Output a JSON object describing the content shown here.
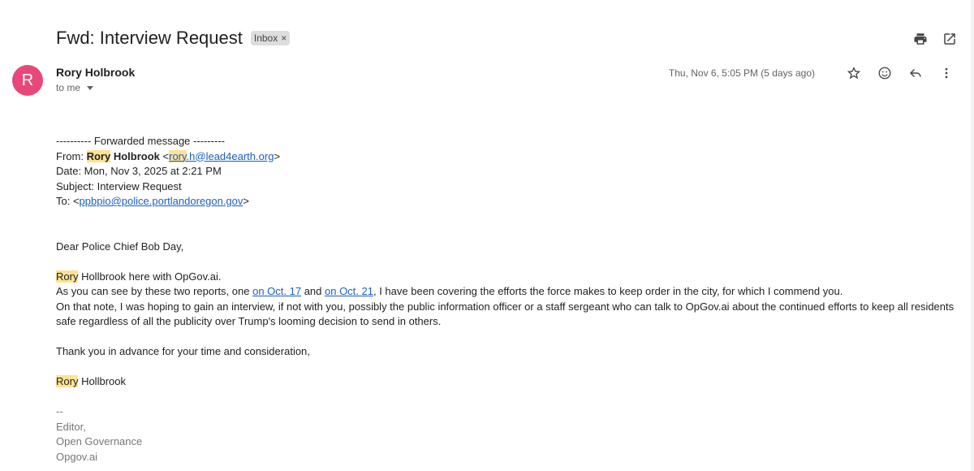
{
  "subject": "Fwd: Interview Request",
  "label": "Inbox",
  "sender": {
    "initial": "R",
    "name": "Rory Holbrook",
    "to": "to me",
    "avatar_color": "#e8477a"
  },
  "timestamp": "Thu, Nov 6, 5:05 PM (5 days ago)",
  "icons": [
    "print-icon",
    "open-in-new-icon",
    "star-icon",
    "emoji-icon",
    "reply-icon",
    "more-vert-icon"
  ],
  "forwarded": {
    "header": "---------- Forwarded message ---------",
    "from_label": "From:",
    "from_first": "Rory",
    "from_last": "Holbrook",
    "email_lt": "<",
    "email_user": "rory",
    "email_rest": ".h@lead4earth.org",
    "email_gt": ">",
    "date": "Date: Mon, Nov 3, 2025 at 2:21 PM",
    "subject": "Subject: Interview Request",
    "to_label": "To: <",
    "to_email": "ppbpio@police.portlandoregon.gov",
    "to_gt": ">"
  },
  "message": {
    "greeting": "Dear Police Chief Bob Day,",
    "intro_name": "Rory",
    "intro_rest": " Hollbrook here with OpGov.ai.",
    "p2_a": "As you can see by these two reports, one ",
    "link1": "on Oct. 17",
    "p2_b": " and ",
    "link2": "on Oct. 21",
    "p2_c": ", I have been covering the efforts the force makes to keep order in the city, for which I commend you.",
    "p3": "On that note, I was hoping to gain an interview, if not with you, possibly the public information officer or a staff sergeant who can talk to OpGov.ai about the continued efforts to keep all residents safe regardless of all the publicity over Trump's looming decision to send in others.",
    "thanks": "Thank you in advance for your time and consideration,",
    "sign_name": "Rory",
    "sign_rest": " Hollbrook"
  },
  "signature": [
    "--",
    "Editor,",
    "Open Governance",
    "Opgov.ai"
  ]
}
